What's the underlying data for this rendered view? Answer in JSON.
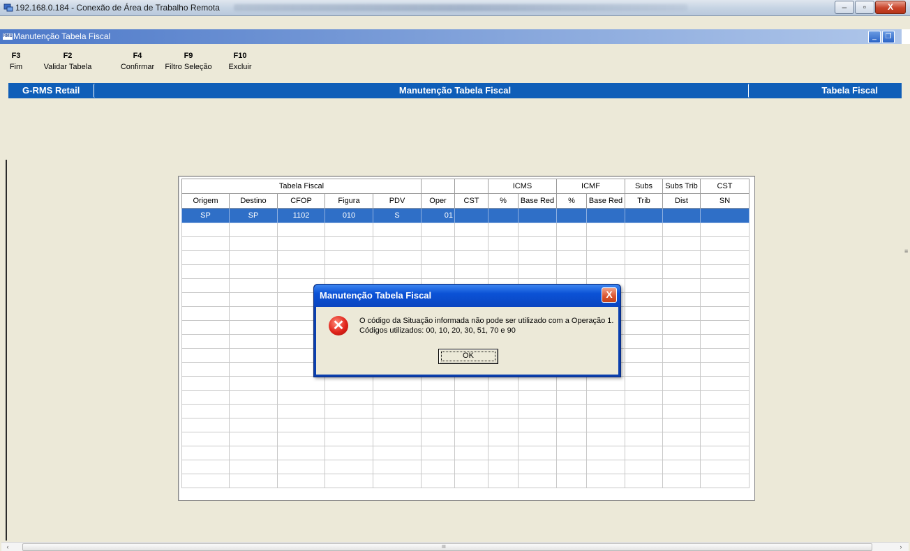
{
  "rdp_window": {
    "title": "192.168.0.184 - Conexão de Área de Trabalho Remota",
    "controls": {
      "minimize": "–",
      "restore": "▫",
      "close": "X"
    }
  },
  "app_window": {
    "badge": "RMS",
    "title": "Manutenção Tabela Fiscal",
    "controls": {
      "minimize": "_",
      "restore": "❐"
    }
  },
  "toolbar": [
    {
      "key": "F3",
      "label": "Fim"
    },
    {
      "key": "F2",
      "label": "Validar Tabela"
    },
    {
      "key": "F4",
      "label": "Confirmar"
    },
    {
      "key": "F9",
      "label": "Filtro Seleção"
    },
    {
      "key": "F10",
      "label": "Excluir"
    }
  ],
  "header_band": {
    "left": "G-RMS Retail",
    "center": "Manutenção Tabela Fiscal",
    "right": "Tabela Fiscal",
    "color": "#0f5eb8"
  },
  "grid": {
    "group_headers": {
      "tabela_fiscal": "Tabela Fiscal",
      "icms": "ICMS",
      "icmf": "ICMF",
      "subs": "Subs",
      "subs_trib": "Subs Trib",
      "cst": "CST"
    },
    "columns": [
      "Origem",
      "Destino",
      "CFOP",
      "Figura",
      "PDV",
      "Oper",
      "CST",
      "%",
      "Base Red",
      "%",
      "Base Red",
      "Trib",
      "Dist",
      "SN"
    ],
    "rows": [
      {
        "selected": true,
        "cells": [
          "SP",
          "SP",
          "1102",
          "010",
          "S",
          "01",
          "",
          "",
          "",
          "",
          "",
          "",
          "",
          ""
        ]
      }
    ],
    "selection_color": "#2f6fc7"
  },
  "dialog": {
    "title": "Manutenção Tabela Fiscal",
    "close": "X",
    "icon": "error-icon",
    "message_line1": "O código da Situação informada não pode ser utilizado com a Operação 1.",
    "message_line2": "Códigos utilizados: 00, 10, 20, 30, 51, 70 e 90",
    "ok_label": "OK"
  },
  "scrollbar": {
    "left": "‹",
    "right": "›",
    "grip": "III"
  }
}
